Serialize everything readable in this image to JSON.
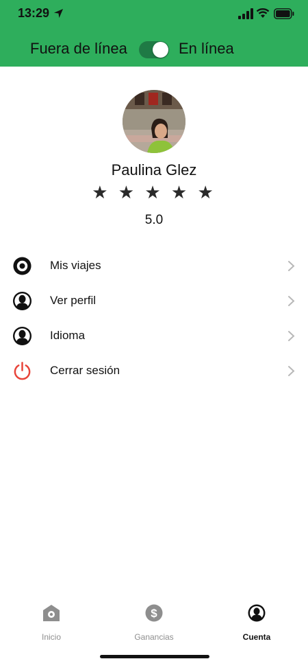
{
  "status_bar": {
    "time": "13:29",
    "icons": [
      "location-arrow-icon",
      "signal-icon",
      "wifi-icon",
      "battery-icon"
    ]
  },
  "header": {
    "offline_label": "Fuera de línea",
    "online_label": "En línea",
    "online": true,
    "color": "#2eae5c"
  },
  "profile": {
    "name": "Paulina Glez",
    "stars": [
      "★",
      "★",
      "★",
      "★",
      "★"
    ],
    "rating": "5.0"
  },
  "menu": {
    "items": [
      {
        "label": "Mis viajes",
        "icon": "trips-icon"
      },
      {
        "label": "Ver perfil",
        "icon": "user-icon"
      },
      {
        "label": "Idioma",
        "icon": "user-icon"
      },
      {
        "label": "Cerrar sesión",
        "icon": "power-icon",
        "color": "#e8443a"
      }
    ]
  },
  "tabbar": {
    "tabs": [
      {
        "label": "Inicio",
        "icon": "home-icon",
        "active": false
      },
      {
        "label": "Ganancias",
        "icon": "dollar-icon",
        "active": false
      },
      {
        "label": "Cuenta",
        "icon": "account-icon",
        "active": true
      }
    ]
  }
}
